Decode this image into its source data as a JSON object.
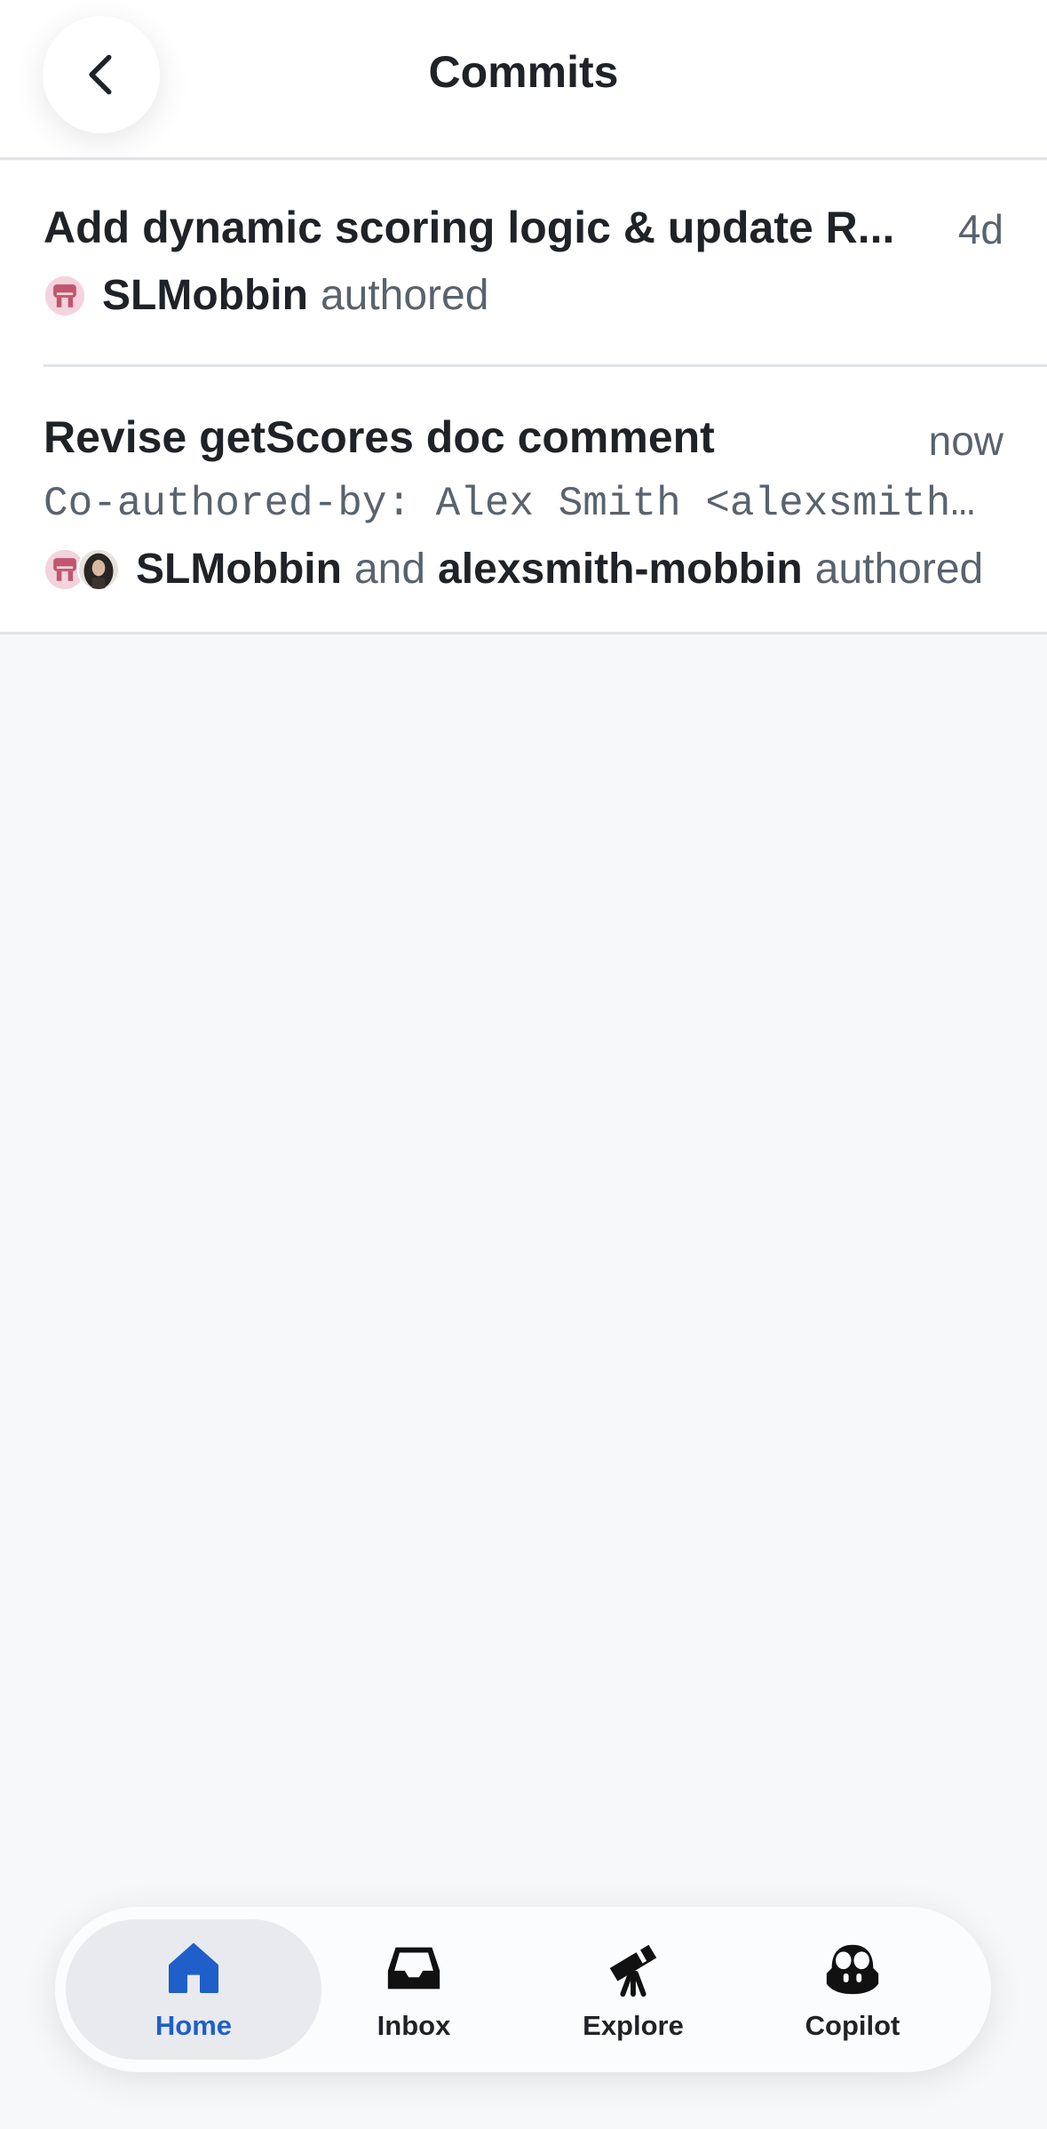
{
  "header": {
    "title": "Commits"
  },
  "commits": [
    {
      "title": "Add dynamic scoring logic & update R...",
      "time": "4d",
      "author": "SLMobbin",
      "verb": "authored"
    },
    {
      "title": "Revise getScores doc comment",
      "time": "now",
      "body": "Co-authored-by: Alex Smith <alexsmith…",
      "author": "SLMobbin",
      "conjunction": "and",
      "coauthor": "alexsmith-mobbin",
      "verb": "authored"
    }
  ],
  "tabbar": {
    "tabs": [
      {
        "label": "Home",
        "icon": "home-icon",
        "active": true
      },
      {
        "label": "Inbox",
        "icon": "inbox-icon",
        "active": false
      },
      {
        "label": "Explore",
        "icon": "telescope-icon",
        "active": false
      },
      {
        "label": "Copilot",
        "icon": "copilot-icon",
        "active": false
      }
    ]
  },
  "colors": {
    "accent": "#1f5fc9",
    "background": "#f6f8fa",
    "muted_text": "#59636e",
    "avatar_brand": "#c0566f"
  }
}
